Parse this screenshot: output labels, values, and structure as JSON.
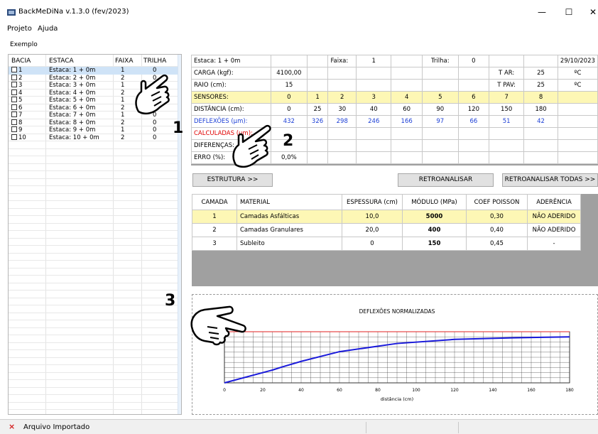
{
  "window": {
    "title": "BackMeDiNa v.1.3.0 (fev/2023)",
    "minimize": "—",
    "maximize": "☐",
    "close": "✕"
  },
  "menu": [
    "Projeto",
    "Ajuda"
  ],
  "project_label": "Exemplo",
  "left_table": {
    "headers": [
      "BACIA",
      "ESTACA",
      "FAIXA",
      "TRILHA"
    ],
    "rows": [
      {
        "bacia": "1",
        "estaca": "Estaca: 1 + 0m",
        "faixa": "1",
        "trilha": "0"
      },
      {
        "bacia": "2",
        "estaca": "Estaca: 2 + 0m",
        "faixa": "2",
        "trilha": "0"
      },
      {
        "bacia": "3",
        "estaca": "Estaca: 3 + 0m",
        "faixa": "1",
        "trilha": "0"
      },
      {
        "bacia": "4",
        "estaca": "Estaca: 4 + 0m",
        "faixa": "2",
        "trilha": "0"
      },
      {
        "bacia": "5",
        "estaca": "Estaca: 5 + 0m",
        "faixa": "1",
        "trilha": "0"
      },
      {
        "bacia": "6",
        "estaca": "Estaca: 6 + 0m",
        "faixa": "2",
        "trilha": "0"
      },
      {
        "bacia": "7",
        "estaca": "Estaca: 7 + 0m",
        "faixa": "1",
        "trilha": "0"
      },
      {
        "bacia": "8",
        "estaca": "Estaca: 8 + 0m",
        "faixa": "2",
        "trilha": "0"
      },
      {
        "bacia": "9",
        "estaca": "Estaca: 9 + 0m",
        "faixa": "1",
        "trilha": "0"
      },
      {
        "bacia": "10",
        "estaca": "Estaca: 10 + 0m",
        "faixa": "2",
        "trilha": "0"
      }
    ]
  },
  "deflection_grid": {
    "header": {
      "estaca": "Estaca: 1 + 0m",
      "faixa_label": "Faixa:",
      "faixa": "1",
      "trilha_label": "Trilha:",
      "trilha": "0",
      "date": "29/10/2023"
    },
    "carga_label": "CARGA (kgf):",
    "carga": "4100,00",
    "raio_label": "RAIO (cm):",
    "raio": "15",
    "tar_label": "T AR:",
    "tar": "25",
    "tar_unit": "ºC",
    "tpav_label": "T PAV:",
    "tpav": "25",
    "tpav_unit": "ºC",
    "sensores_label": "SENSORES:",
    "sensores": [
      "0",
      "1",
      "2",
      "3",
      "4",
      "5",
      "6",
      "7",
      "8"
    ],
    "distancia_label": "DISTÂNCIA (cm):",
    "distancia": [
      "0",
      "25",
      "30",
      "40",
      "60",
      "90",
      "120",
      "150",
      "180"
    ],
    "deflexoes_label": "DEFLEXÕES (µm):",
    "deflexoes": [
      "432",
      "326",
      "298",
      "246",
      "166",
      "97",
      "66",
      "51",
      "42"
    ],
    "calculadas_label": "CALCULADAS (µm):",
    "diferencas_label": "DIFERENÇAS:",
    "erro_label": "ERRO (%):",
    "erro": "0,0%"
  },
  "buttons": {
    "estrutura": "ESTRUTURA >>",
    "retroanalisar": "RETROANALISAR",
    "retroanalisar_todas": "RETROANALISAR TODAS >>"
  },
  "layers": {
    "headers": [
      "CAMADA",
      "MATERIAL",
      "ESPESSURA (cm)",
      "MÓDULO (MPa)",
      "COEF POISSON",
      "ADERÊNCIA"
    ],
    "rows": [
      {
        "camada": "1",
        "material": "Camadas Asfálticas",
        "espessura": "10,0",
        "modulo": "5000",
        "poisson": "0,30",
        "aderencia": "NÃO ADERIDO"
      },
      {
        "camada": "2",
        "material": "Camadas Granulares",
        "espessura": "20,0",
        "modulo": "400",
        "poisson": "0,40",
        "aderencia": "NÃO ADERIDO"
      },
      {
        "camada": "3",
        "material": "Subleito",
        "espessura": "0",
        "modulo": "150",
        "poisson": "0,45",
        "aderencia": "-"
      }
    ]
  },
  "chart_data": {
    "type": "line",
    "title": "DEFLEXÕES NORMALIZADAS",
    "xlabel": "distância (cm)",
    "ylabel": "",
    "xlim": [
      0,
      180
    ],
    "ylim": [
      0,
      1
    ],
    "x_ticks": [
      "0",
      "20",
      "40",
      "60",
      "80",
      "100",
      "120",
      "140",
      "160",
      "180"
    ],
    "grid": true,
    "series": [
      {
        "color": "#1a1adb",
        "x": [
          0,
          25,
          30,
          40,
          60,
          90,
          120,
          150,
          180
        ],
        "y": [
          0.0,
          0.25,
          0.31,
          0.42,
          0.61,
          0.77,
          0.85,
          0.88,
          0.9
        ]
      },
      {
        "color": "#e02020",
        "x": [
          0,
          180
        ],
        "y": [
          1.0,
          1.0
        ]
      }
    ]
  },
  "annotations": [
    "1",
    "2",
    "3"
  ],
  "status": {
    "icon": "×",
    "text": "Arquivo Importado"
  }
}
